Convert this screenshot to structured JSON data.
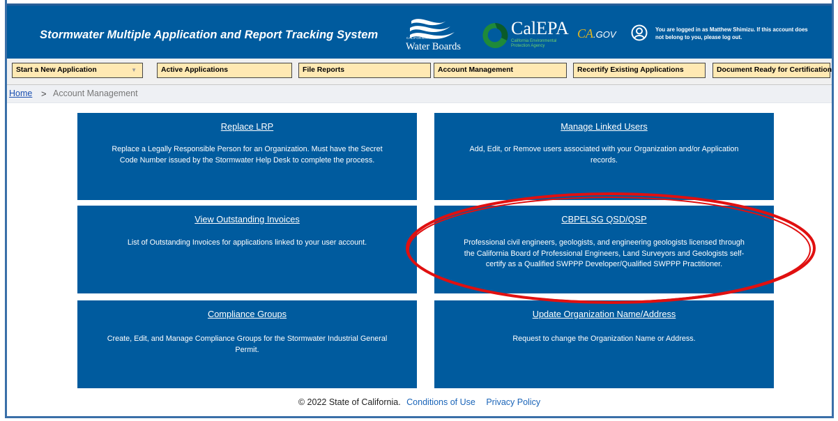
{
  "header": {
    "title": "Stormwater Multiple Application and Report Tracking System",
    "water_boards": "Water Boards",
    "water_boards_small": "CALIFORNIA",
    "calepa": "CalEPA",
    "calepa_sub": "California Environmental Protection Agency",
    "cagov_ca": "CA",
    "cagov_gov": ".GOV",
    "login_message": "You are logged in as Matthew Shimizu. If this account does not belong to you, please log out."
  },
  "nav": [
    {
      "label": "Start a New Application"
    },
    {
      "label": "Active Applications"
    },
    {
      "label": "File Reports"
    },
    {
      "label": "Account Management"
    },
    {
      "label": "Recertify Existing Applications"
    },
    {
      "label": "Document Ready for Certification"
    }
  ],
  "breadcrumb": {
    "home": "Home",
    "current": "Account Management"
  },
  "tiles": [
    {
      "title": "Replace LRP",
      "desc": "Replace a Legally Responsible Person for an Organization. Must have the Secret Code Number issued by the Stormwater Help Desk to complete the process."
    },
    {
      "title": "Manage Linked Users",
      "desc": "Add, Edit, or Remove users associated with your Organization and/or Application records."
    },
    {
      "title": "View Outstanding Invoices",
      "desc": "List of Outstanding Invoices for applications linked to your user account."
    },
    {
      "title": "CBPELSG QSD/QSP",
      "desc": "Professional civil engineers, geologists, and engineering geologists licensed through the California Board of Professional Engineers, Land Surveyors and Geologists self-certify as a Qualified SWPPP Developer/Qualified SWPPP Practitioner."
    },
    {
      "title": "Compliance Groups",
      "desc": "Create, Edit, and Manage Compliance Groups for the Stormwater Industrial General Permit."
    },
    {
      "title": "Update Organization Name/Address",
      "desc": "Request to change the Organization Name or Address."
    }
  ],
  "footer": {
    "copyright": "© 2022 State of California.",
    "conditions": "Conditions of Use",
    "privacy": "Privacy Policy"
  },
  "colors": {
    "brand_blue": "#005b9e",
    "nav_button": "#ffe9b3",
    "highlight_ellipse": "#e01010"
  },
  "icons": [
    "water-boards-logo",
    "calepa-logo",
    "user-icon",
    "chevron-right-icon",
    "caret-down-icon"
  ]
}
